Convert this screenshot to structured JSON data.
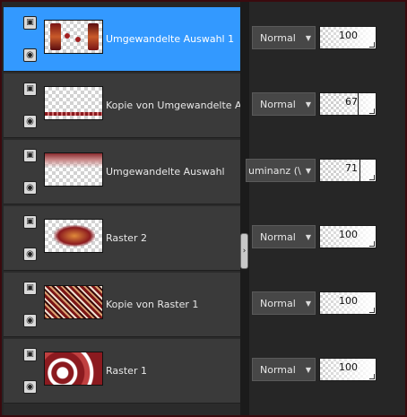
{
  "layers": [
    {
      "name": "Umgewandelte Auswahl 1",
      "blend": "Normal",
      "opacity": "100",
      "opacity_fraction": 1.0,
      "selected": true,
      "thumb": "wand"
    },
    {
      "name": "Kopie von Umgewandelte Au",
      "blend": "Normal",
      "opacity": "67",
      "opacity_fraction": 0.67,
      "selected": false,
      "thumb": "bottom-strip"
    },
    {
      "name": "Umgewandelte Auswahl",
      "blend": "uminanz (\\",
      "opacity": "71",
      "opacity_fraction": 0.71,
      "selected": false,
      "thumb": "top-glow"
    },
    {
      "name": "Raster 2",
      "blend": "Normal",
      "opacity": "100",
      "opacity_fraction": 1.0,
      "selected": false,
      "thumb": "center-blob"
    },
    {
      "name": "Kopie von Raster 1",
      "blend": "Normal",
      "opacity": "100",
      "opacity_fraction": 1.0,
      "selected": false,
      "thumb": "mosaic"
    },
    {
      "name": "Raster 1",
      "blend": "Normal",
      "opacity": "100",
      "opacity_fraction": 1.0,
      "selected": false,
      "thumb": "swirl"
    }
  ],
  "icons": {
    "layer_type": "layer-stack-icon",
    "visibility": "eye-icon",
    "dropdown": "chevron-down-icon",
    "splitter": "splitter-arrow-icon"
  },
  "colors": {
    "selection": "#3399ff",
    "row": "#3a3a3a",
    "background": "#262626",
    "frame": "#3a0a0e",
    "accent_red": "#8b1a1f"
  }
}
